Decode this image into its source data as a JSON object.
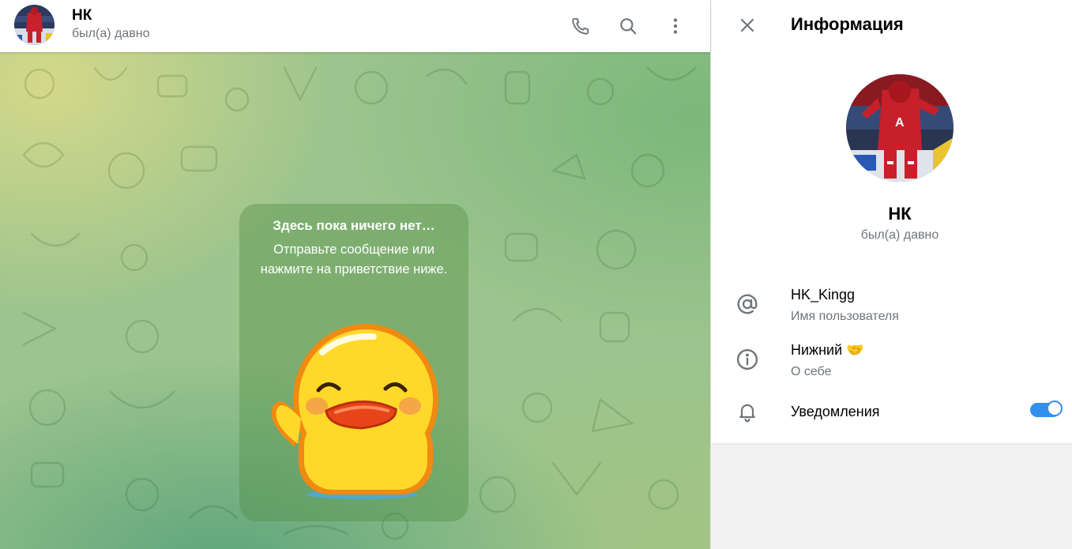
{
  "chat_header": {
    "name": "НК",
    "status": "был(а) давно",
    "avatar_icon": "avatar-hockey-player",
    "actions": [
      "phone-icon",
      "search-icon",
      "more-vertical-icon"
    ]
  },
  "empty_state": {
    "title": "Здесь пока ничего нет…",
    "text": "Отправьте сообщение или нажмите на приветствие ниже.",
    "sticker": "waving-duck-sticker"
  },
  "info_panel": {
    "title": "Информация",
    "close_icon": "close-icon",
    "profile": {
      "name": "НК",
      "status": "был(а) давно"
    },
    "username": {
      "value": "HK_Kingg",
      "label": "Имя пользователя",
      "icon": "at-sign-icon"
    },
    "bio": {
      "value": "Нижний 🤝",
      "label": "О себе",
      "icon": "info-icon"
    },
    "notifications": {
      "label": "Уведомления",
      "icon": "bell-icon",
      "enabled": true
    }
  },
  "colors": {
    "accent": "#3390ec",
    "secondary_text": "#707579",
    "icon": "#707579",
    "panel_bg": "#f1f1f1"
  }
}
